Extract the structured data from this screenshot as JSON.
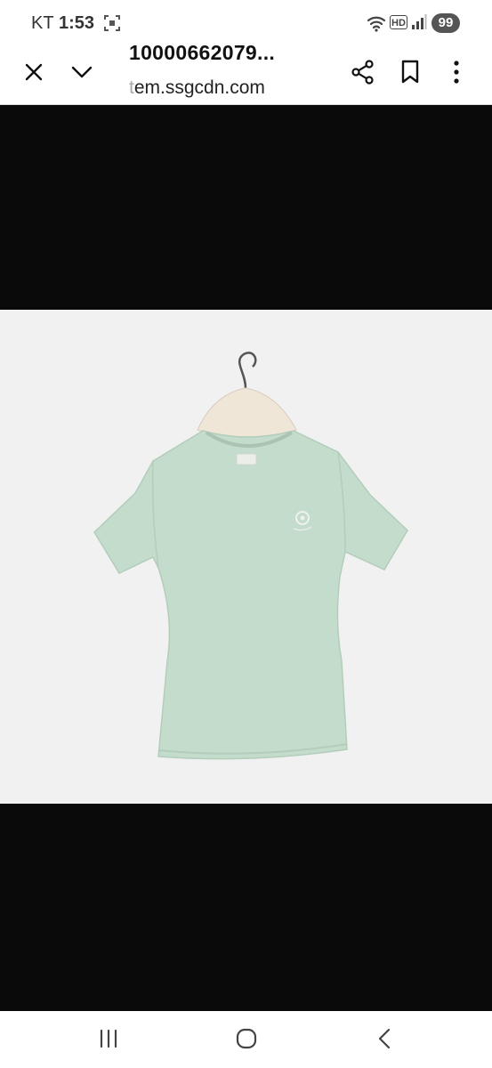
{
  "status_bar": {
    "carrier": "KT",
    "time": "1:53",
    "battery": "99",
    "hd_label": "HD"
  },
  "toolbar": {
    "title": "10000662079...",
    "url_prefix": "",
    "url_faded": "t",
    "url_main": "em.ssgcdn.com"
  },
  "viewer": {
    "image_alt": "Mint green short-sleeve t-shirt on hanger",
    "image_bg": "#f1f1f1",
    "shirt_color": "#c4dccb",
    "viewer_bg": "#0a0a0a"
  },
  "icons": {
    "close": "close-icon",
    "minimize": "chevron-down-icon",
    "share": "share-icon",
    "bookmark": "bookmark-icon",
    "more": "more-vertical-icon",
    "recents": "recents-icon",
    "home": "home-icon",
    "back": "back-icon"
  }
}
